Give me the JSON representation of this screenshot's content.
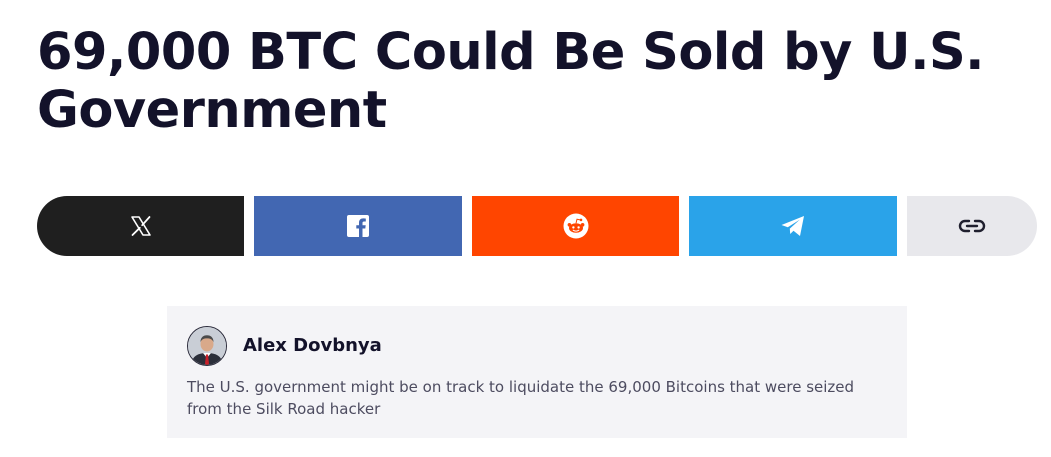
{
  "article": {
    "title": "69,000 BTC Could Be Sold by U.S. Government"
  },
  "share": {
    "buttons": [
      {
        "network": "x",
        "icon": "x-logo-icon",
        "color": "#1f1f1f"
      },
      {
        "network": "facebook",
        "icon": "facebook-icon",
        "color": "#4267b2"
      },
      {
        "network": "reddit",
        "icon": "reddit-icon",
        "color": "#ff4500"
      },
      {
        "network": "telegram",
        "icon": "telegram-icon",
        "color": "#2aa3e9"
      },
      {
        "network": "copy-link",
        "icon": "link-icon",
        "color": "#e8e8ec"
      }
    ]
  },
  "author": {
    "name": "Alex Dovbnya",
    "summary": "The U.S. government might be on track to liquidate the 69,000 Bitcoins that were seized from the Silk Road hacker"
  }
}
